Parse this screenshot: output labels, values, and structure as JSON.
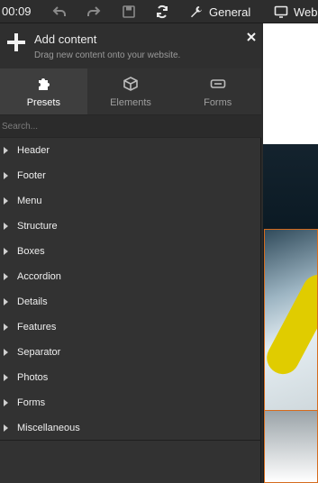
{
  "toolbar": {
    "time": "00:09",
    "general_label": "General",
    "web_label": "Web"
  },
  "panel": {
    "title": "Add content",
    "subtitle": "Drag new content onto your website.",
    "tabs": [
      {
        "label": "Presets",
        "icon": "puzzle-icon"
      },
      {
        "label": "Elements",
        "icon": "cube-icon"
      },
      {
        "label": "Forms",
        "icon": "form-field-icon"
      }
    ],
    "search_placeholder": "Search...",
    "items": [
      {
        "label": "Header"
      },
      {
        "label": "Footer"
      },
      {
        "label": "Menu"
      },
      {
        "label": "Structure"
      },
      {
        "label": "Boxes"
      },
      {
        "label": "Accordion"
      },
      {
        "label": "Details"
      },
      {
        "label": "Features"
      },
      {
        "label": "Separator"
      },
      {
        "label": "Photos"
      },
      {
        "label": "Forms"
      },
      {
        "label": "Miscellaneous"
      }
    ]
  },
  "colors": {
    "accent_frame": "#d56b1d"
  }
}
